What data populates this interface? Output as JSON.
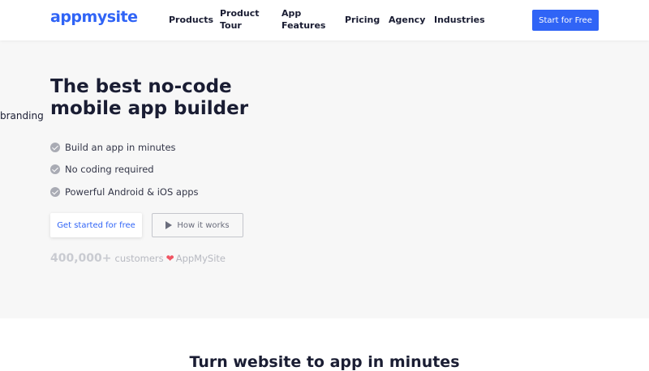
{
  "header": {
    "logo": "appmysite",
    "nav": [
      "Products",
      "Product Tour",
      "App Features",
      "Pricing",
      "Agency",
      "Industries"
    ],
    "cta_label": "Start for Free"
  },
  "hero": {
    "side_fragment": "branding",
    "title": "The best no-code mobile app builder",
    "features": [
      "Build an app in minutes",
      "No coding required",
      "Powerful Android & iOS apps"
    ],
    "primary_button": "Get started for free",
    "secondary_button": "How it works",
    "stats": {
      "count": "400,000+",
      "label": "customers",
      "brand": "AppMySite"
    }
  },
  "section": {
    "title": "Turn website to app in minutes"
  },
  "colors": {
    "brand_blue": "#3064f6",
    "heart_red": "#f05563",
    "hero_bg": "#f7f7f7"
  },
  "icons": {
    "check": "check-circle-icon",
    "play": "play-icon",
    "heart": "heart-icon"
  }
}
